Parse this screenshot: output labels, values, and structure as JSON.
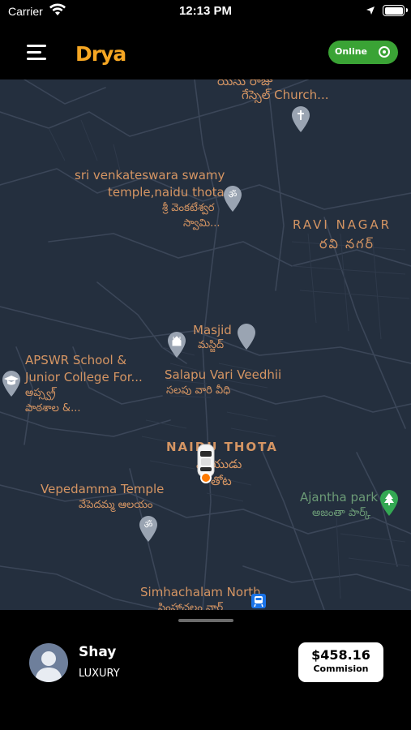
{
  "status_bar": {
    "carrier": "Carrier",
    "time": "12:13 PM",
    "icons": [
      "wifi-icon",
      "location-arrow-icon",
      "battery-icon"
    ]
  },
  "header": {
    "menu_icon": "hamburger-menu-icon",
    "logo_text": "Drya",
    "logo_color": "#f5a623",
    "status_toggle": {
      "label": "Online",
      "state": "on",
      "color": "#3aa335"
    }
  },
  "map": {
    "background_color": "#242f3e",
    "label_color": "#d59563",
    "labels": {
      "church_te": "గేస్సెల్ Church...",
      "church_top": "యేసు రాజు",
      "temple_sv_1": "sri venkateswara swamy",
      "temple_sv_2": "temple,naidu thota",
      "temple_sv_te_1": "శ్రీ వెంకటేశ్వర",
      "temple_sv_te_2": "స్వామి...",
      "ravi_nagar": "RAVI NAGAR",
      "ravi_nagar_te": "రవి నగర్",
      "masjid": "Masjid",
      "masjid_te": "మస్జిద్",
      "apswr_1": "APSWR School &",
      "apswr_2": "Junior College For...",
      "apswr_te_1": "అప్స్వ్ర్",
      "apswr_te_2": "పాఠశాల &...",
      "street": "Salapu Vari Veedhii",
      "street_te": "సలపు వారి వీధి",
      "naidu_thota": "NAIDU THOTA",
      "naidu_thota_te_1": "నాయుడు",
      "naidu_thota_te_2": "తోట",
      "vepedamma": "Vepedamma Temple",
      "vepedamma_te": "వేపెదమ్మ ఆలయం",
      "ajantha": "Ajantha park",
      "ajantha_te": "అజంతా పార్క్",
      "simhachalam": "Simhachalam North",
      "simhachalam_te": "సింహాచలం నార్త్"
    },
    "markers": [
      "church-pin-icon",
      "om-temple-pin-icon",
      "mosque-pin-icon",
      "mosque-building-pin-icon",
      "school-pin-icon",
      "om-temple-pin-icon",
      "park-tree-pin-icon",
      "train-station-icon",
      "car-marker-icon"
    ]
  },
  "driver_panel": {
    "name": "Shay",
    "vehicle_class": "LUXURY",
    "commission_amount": "$458.16",
    "commission_label": "Commision"
  }
}
